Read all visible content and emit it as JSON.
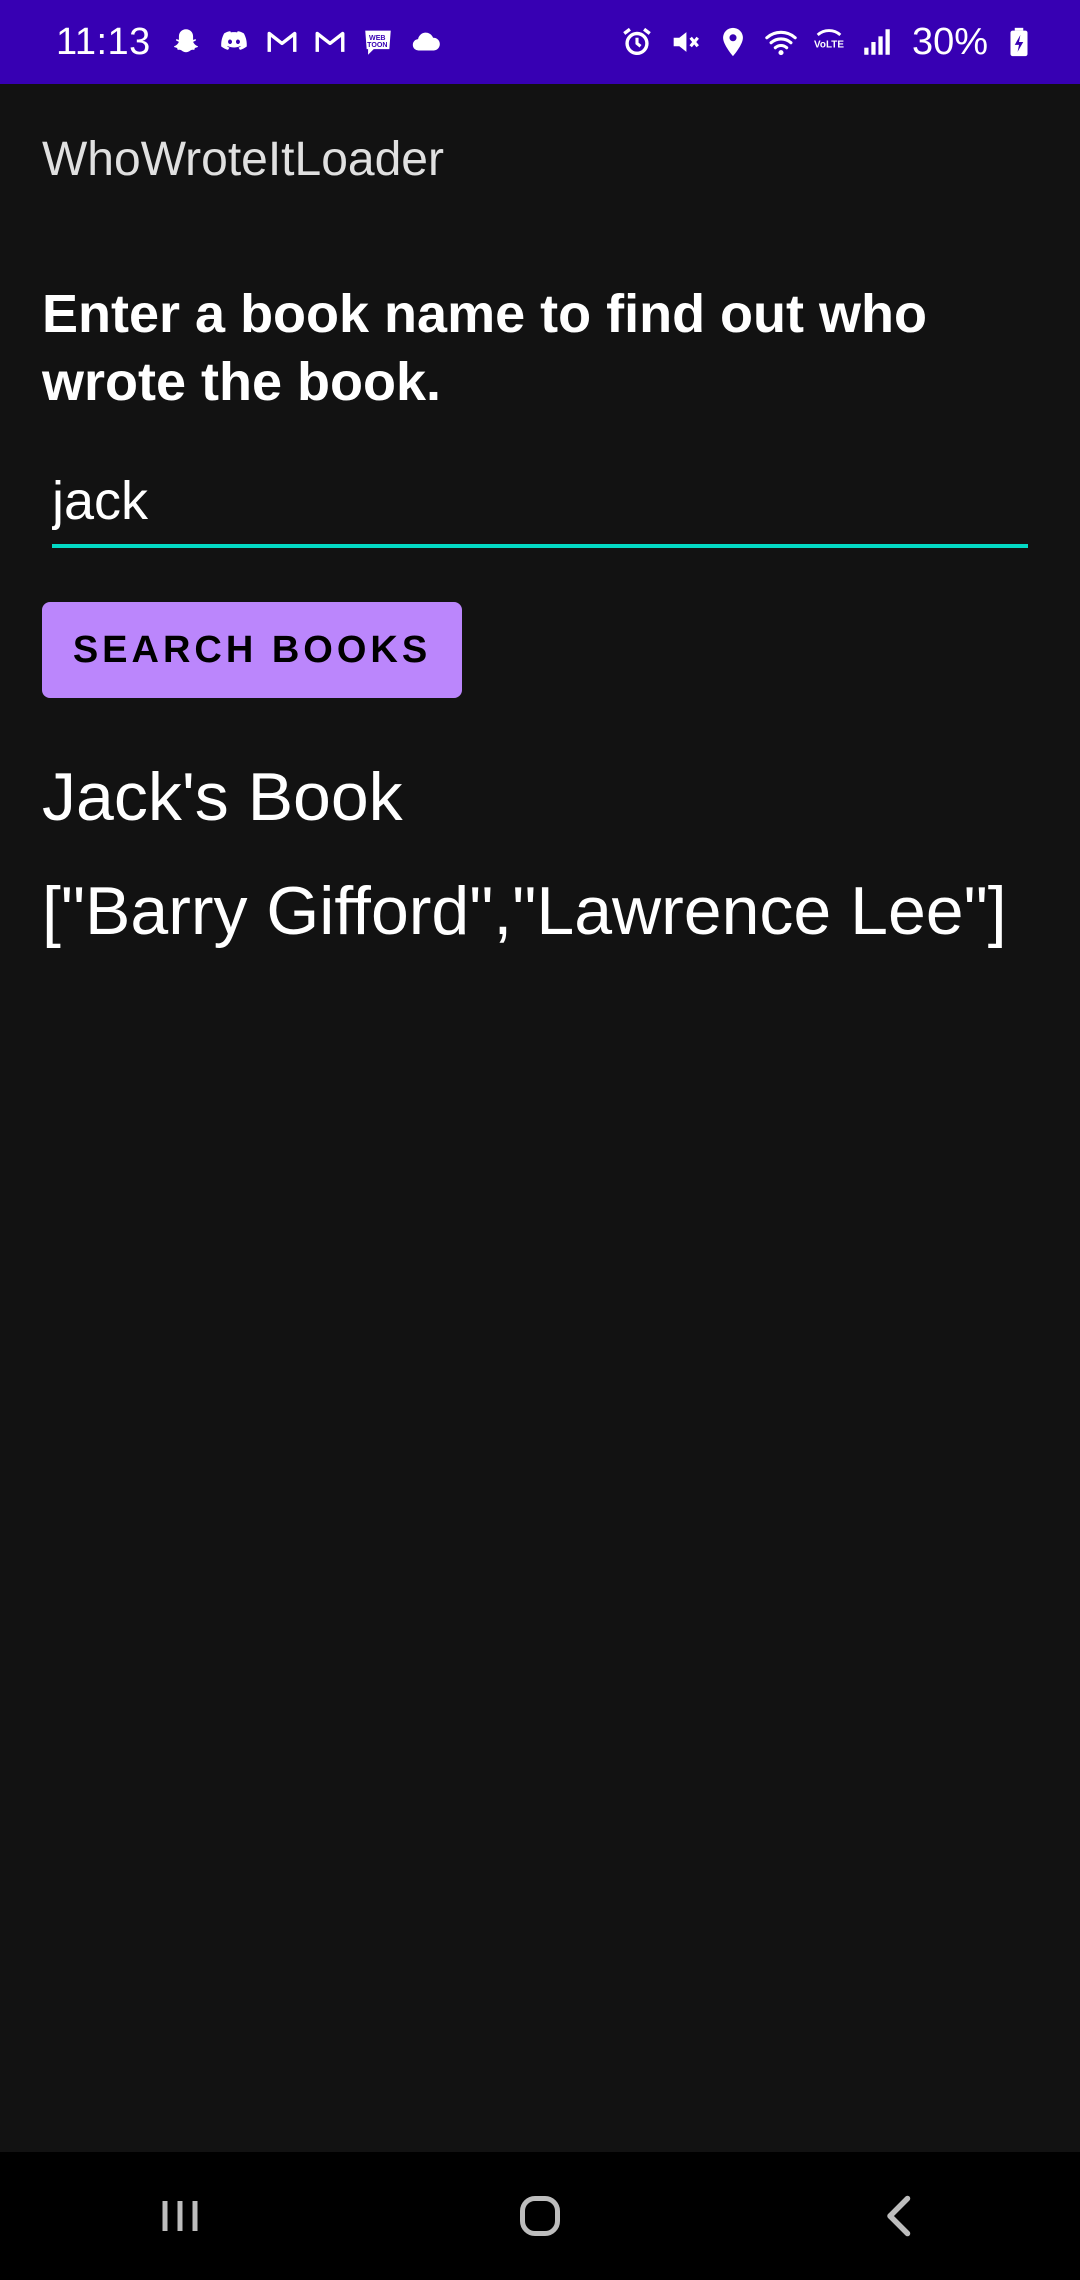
{
  "status_bar": {
    "time": "11:13",
    "battery": "30%",
    "left_icons": [
      "snapchat-icon",
      "discord-icon",
      "gmail-icon",
      "gmail-icon",
      "webtoon-icon",
      "cloud-icon"
    ],
    "right_icons": [
      "alarm-icon",
      "mute-icon",
      "location-icon",
      "wifi-icon",
      "volte-icon",
      "signal-icon",
      "battery-charging-icon"
    ]
  },
  "app_bar": {
    "title": "WhoWroteItLoader"
  },
  "main": {
    "instructions": "Enter a book name to find out who wrote the book.",
    "book_input": {
      "value": "jack",
      "placeholder": ""
    },
    "search_button_label": "SEARCH BOOKS",
    "result_title": "Jack's Book",
    "result_authors": "[\"Barry Gifford\",\"Lawrence Lee\"]"
  },
  "nav_bar": {
    "buttons": [
      "recent-apps-icon",
      "home-icon",
      "back-icon"
    ]
  },
  "colors": {
    "status_bar": "#3700b3",
    "background": "#121212",
    "accent_underline": "#03dac5",
    "button": "#bb86fc"
  }
}
